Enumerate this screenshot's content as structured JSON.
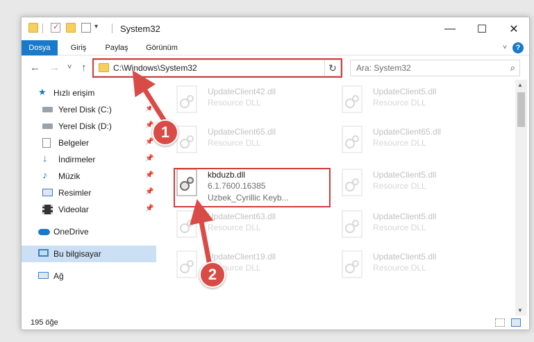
{
  "window": {
    "title": "System32",
    "minimize": "—",
    "maximize": "☐",
    "close": "✕"
  },
  "ribbon": {
    "tabs": [
      "Dosya",
      "Giriş",
      "Paylaş",
      "Görünüm"
    ],
    "active_tab": "Dosya",
    "help": "?"
  },
  "nav": {
    "back": "←",
    "forward": "→",
    "recent": "˅",
    "up": "↑",
    "address": "C:\\Windows\\System32",
    "address_dropdown": "˅",
    "refresh": "↻",
    "search_placeholder": "Ara: System32",
    "search_icon": "⌕"
  },
  "sidebar": {
    "quick_access": "Hızlı erişim",
    "items": [
      {
        "label": "Yerel Disk (C:)",
        "icon": "drive-icon",
        "pinned": true
      },
      {
        "label": "Yerel Disk (D:)",
        "icon": "drive-icon",
        "pinned": true
      },
      {
        "label": "Belgeler",
        "icon": "documents-icon",
        "pinned": true
      },
      {
        "label": "İndirmeler",
        "icon": "download-icon",
        "pinned": true
      },
      {
        "label": "Müzik",
        "icon": "music-icon",
        "pinned": true
      },
      {
        "label": "Resimler",
        "icon": "pictures-icon",
        "pinned": true
      },
      {
        "label": "Videolar",
        "icon": "videos-icon",
        "pinned": true
      }
    ],
    "onedrive": "OneDrive",
    "this_pc": "Bu bilgisayar",
    "network": "Ağ"
  },
  "files": {
    "selected": {
      "name": "kbduzb.dll",
      "version": "6.1.7600.16385",
      "description": "Uzbek_Cyrillic Keyb..."
    },
    "ghosts": [
      {
        "name": "UpdateClient42.dll",
        "type": "Resource DLL"
      },
      {
        "name": "UpdateClient5.dll",
        "type": "Resource DLL"
      },
      {
        "name": "UpdateClient65.dll",
        "type": "Resource DLL"
      },
      {
        "name": "UpdateClient65.dll",
        "type": "Resource DLL"
      },
      {
        "name": "UpdateClient5.dll",
        "type": "Resource DLL"
      },
      {
        "name": "UpdateClient63.dll",
        "type": "Resource DLL"
      },
      {
        "name": "UpdateClient5.dll",
        "type": "Resource DLL"
      },
      {
        "name": "UpdateClient19.dll",
        "type": "Resource DLL"
      },
      {
        "name": "UpdateClient5.dll",
        "type": "Resource DLL"
      }
    ]
  },
  "status": {
    "count": "195 öğe"
  },
  "callouts": [
    "1",
    "2"
  ],
  "colors": {
    "accent": "#1979ca",
    "highlight_border": "#d03a3a",
    "callout": "#d94b46",
    "selection": "#cce0f5"
  }
}
